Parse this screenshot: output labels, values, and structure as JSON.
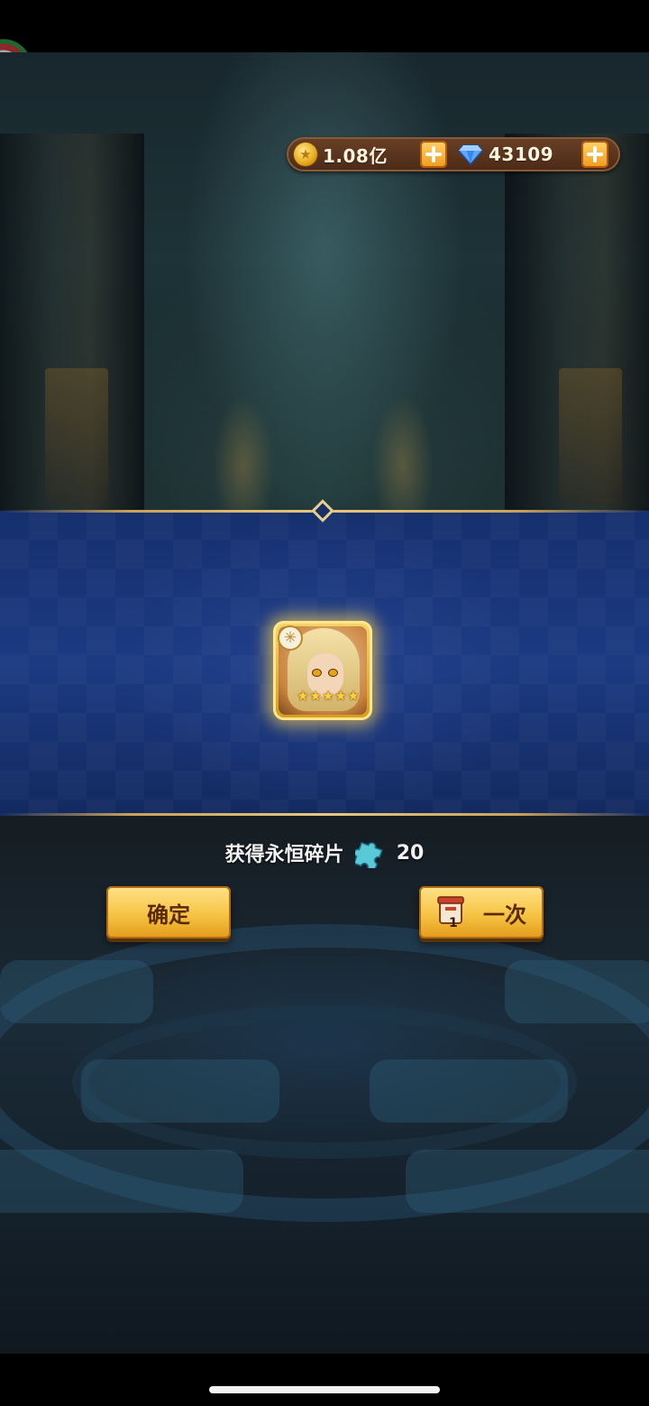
{
  "resources": {
    "gold": {
      "value": "1.08亿",
      "icon": "gold-coin-icon"
    },
    "gems": {
      "value": "43109",
      "icon": "diamond-gem-icon"
    }
  },
  "reward": {
    "hero_stars": 5,
    "hero_element_icon": "light-element-icon",
    "label": "获得永恒碎片",
    "item_icon": "puzzle-piece-icon",
    "count": "20"
  },
  "buttons": {
    "confirm": "确定",
    "once": "一次",
    "once_ticket_count": "1"
  },
  "colors": {
    "panel_blue": "#1b3a82",
    "button_gold": "#f6c443",
    "resource_bar": "#5a331d",
    "glow": "#ffd250"
  }
}
